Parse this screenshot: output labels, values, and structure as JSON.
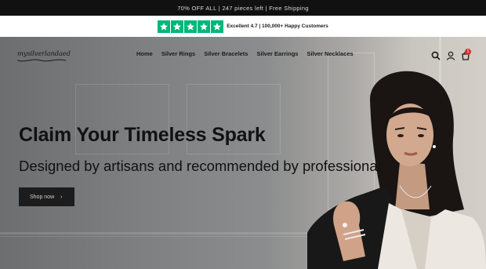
{
  "announcement": "70% OFF ALL | 247 pieces left | Free Shipping",
  "trust": {
    "text": "Excellent 4.7 | 100,000+ Happy Customers",
    "rating_stars": 5,
    "star_color": "#00b67a"
  },
  "header": {
    "logo_text": "mysilverlandaed",
    "nav": [
      "Home",
      "Silver Rings",
      "Silver Bracelets",
      "Silver Earrings",
      "Silver Necklaces"
    ],
    "icons": [
      "search-icon",
      "account-icon",
      "cart-icon"
    ],
    "cart_count": "1"
  },
  "hero": {
    "title": "Claim Your Timeless Spark",
    "subtitle": "Designed by artisans and recommended by professional",
    "cta_label": "Shop now",
    "cta_icon": "chevron-right-icon"
  }
}
